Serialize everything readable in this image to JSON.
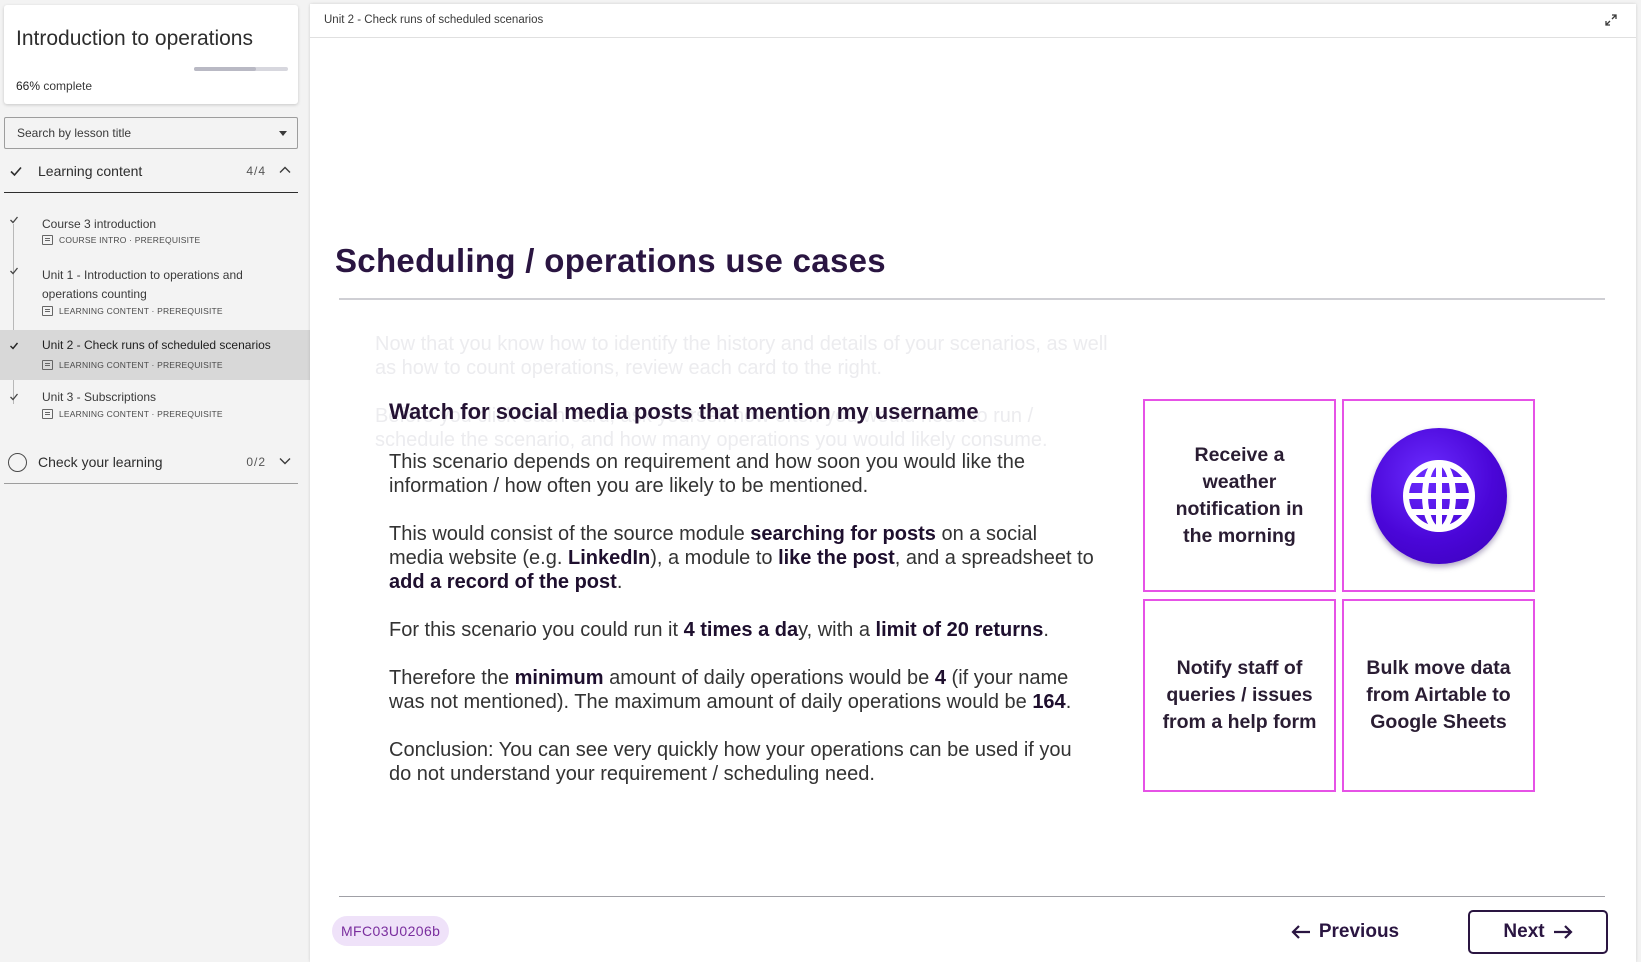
{
  "course": {
    "title": "Introduction to operations",
    "progress_percent": "66%",
    "progress_suffix": "complete",
    "progress_fraction": 0.66
  },
  "search": {
    "placeholder": "Search by lesson title"
  },
  "sections": [
    {
      "label": "Learning content",
      "count": "4/4",
      "complete": true,
      "expanded": true
    },
    {
      "label": "Check your learning",
      "count": "0/2",
      "complete": false,
      "expanded": false
    }
  ],
  "lessons": [
    {
      "title": "Course 3 introduction",
      "meta": "COURSE INTRO · PREREQUISITE"
    },
    {
      "title": "Unit 1 - Introduction to operations and operations counting",
      "meta": "LEARNING CONTENT · PREREQUISITE"
    },
    {
      "title": "Unit 2 - Check runs of scheduled scenarios",
      "meta": "LEARNING CONTENT · PREREQUISITE",
      "active": true
    },
    {
      "title": "Unit 3 - Subscriptions",
      "meta": "LEARNING CONTENT · PREREQUISITE"
    }
  ],
  "main": {
    "breadcrumb": "Unit 2 - Check runs of scheduled scenarios",
    "page_title": "Scheduling / operations use cases",
    "ghost_text_1": "Now that you know how to identify the history and details of your scenarios, as well as how to count operations, review each card to the right.",
    "ghost_text_2": "Before you click each card, ask yourself how often you would need to run / schedule the scenario, and how many operations you would likely consume.",
    "popup": {
      "title": "Watch for social media posts that mention my username",
      "p1": "This scenario depends on requirement and how soon you would like the information / how often you are likely to be mentioned.",
      "p2": {
        "t1": "This would consist of the source module ",
        "b1": "searching for posts",
        "t2": " on a social media website (e.g. ",
        "b2": "LinkedIn",
        "t3": "), a module to ",
        "b3": "like the post",
        "t4": ", and a spreadsheet to ",
        "b4": "add a record of the post",
        "t5": "."
      },
      "p3": {
        "t1": "For this scenario you could run it ",
        "b1": "4 times a da",
        "t2": "y, with a ",
        "b2": "limit of 20 returns",
        "t3": "."
      },
      "p4": {
        "t1": "Therefore the ",
        "b1": "minimum",
        "t2": " amount of daily operations would be ",
        "b2": "4",
        "t3": " (if your name was not mentioned). The maximum amount of daily operations would be ",
        "b3": "164",
        "t4": "."
      },
      "p5": "Conclusion: You can see very quickly how your operations can be used if you do not understand your requirement / scheduling need."
    },
    "cards": [
      {
        "label": "Receive a weather notification in the morning"
      },
      {
        "label": "",
        "icon": "globe-icon"
      },
      {
        "label": "Notify staff of queries / issues from a help form"
      },
      {
        "label": "Bulk move data from Airtable to Google Sheets"
      }
    ],
    "code": "MFC03U0206b",
    "prev_label": "Previous",
    "next_label": "Next"
  },
  "colors": {
    "title": "#2a1541",
    "card_border": "#e652e6",
    "globe": "#4a06d8",
    "badge_bg": "#efe2f9",
    "badge_text": "#7a2e9e"
  }
}
